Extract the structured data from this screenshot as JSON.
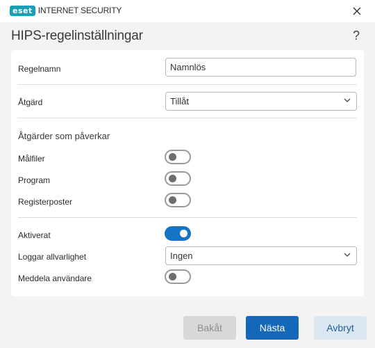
{
  "window": {
    "brand_badge": "eset",
    "brand_text": "INTERNET SECURITY"
  },
  "header": {
    "title": "HIPS-regelinställningar",
    "help": "?"
  },
  "form": {
    "rule_name": {
      "label": "Regelnamn",
      "value": "Namnlös"
    },
    "action": {
      "label": "Åtgärd",
      "value": "Tillåt"
    },
    "affected_heading": "Åtgärder som påverkar",
    "target_files": {
      "label": "Målfiler",
      "enabled": false
    },
    "program": {
      "label": "Program",
      "enabled": false
    },
    "registry": {
      "label": "Registerposter",
      "enabled": false
    },
    "activated": {
      "label": "Aktiverat",
      "enabled": true
    },
    "log_severity": {
      "label": "Loggar allvarlighet",
      "value": "Ingen"
    },
    "notify_user": {
      "label": "Meddela användare",
      "enabled": false
    }
  },
  "footer": {
    "back": "Bakåt",
    "next": "Nästa",
    "cancel": "Avbryt"
  },
  "colors": {
    "accent": "#1468b7",
    "brand": "#1a9fb3"
  }
}
